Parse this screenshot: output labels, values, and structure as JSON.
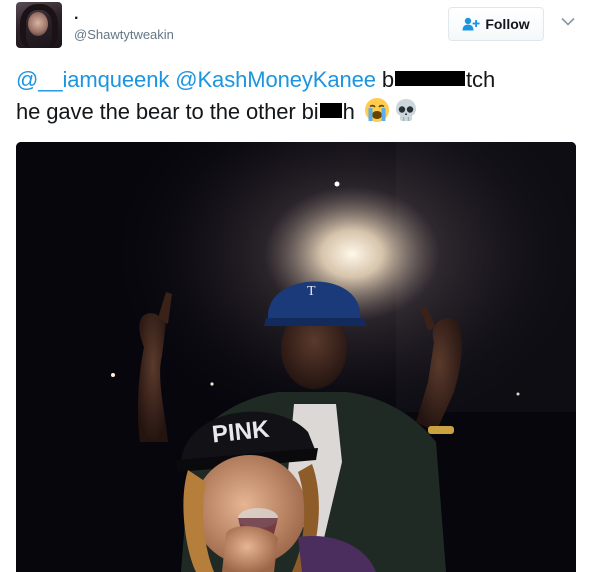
{
  "user": {
    "display_name": ".",
    "handle": "@Shawtytweakin"
  },
  "follow": {
    "label": "Follow",
    "icon": "add-user-icon"
  },
  "menu": {
    "icon": "chevron-down-icon"
  },
  "tweet": {
    "mention_1": "@__iamqueenk",
    "mention_2": "@KashMoneyKanee",
    "part_1": "b",
    "part_2": "tch",
    "part_3": "he gave the bear to the other bi",
    "part_4": "h",
    "emoji_1": "😭",
    "emoji_2": "💀"
  },
  "photo": {
    "cap_text_1": "PINK",
    "cap_letter_2": "T"
  },
  "colors": {
    "link": "#1b95e0",
    "text": "#14171a",
    "secondary": "#657786"
  }
}
